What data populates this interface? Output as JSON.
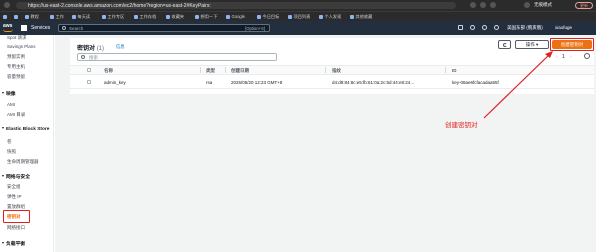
{
  "browser": {
    "url": "https://us-east-2.console.aws.amazon.com/ec2/home?region=us-east-2#KeyPairs:",
    "incognito_label": "无痕模式",
    "update_label": "更新",
    "bookmarks": [
      "",
      "",
      "教程",
      "工作",
      "每天读",
      "工作专区",
      "工作存档",
      "收藏夹",
      "想用一下",
      "Google",
      "今日目标",
      "项目列表",
      "个人发现",
      "其他收藏"
    ]
  },
  "aws_nav": {
    "logo": "aws",
    "services_label": "Services",
    "search_placeholder": "Search",
    "search_shortcut": "[Option+S]",
    "region": "美国东部 (俄亥俄)",
    "user": "xiaofuge"
  },
  "sidebar": {
    "top_items": [
      "Spot 请求",
      "Savings Plans",
      "预留实例",
      "专用主机",
      "容量预留"
    ],
    "sections": [
      {
        "title": "映像",
        "items": [
          "AMI",
          "AMI 目录"
        ]
      },
      {
        "title": "Elastic Block Store",
        "items": [
          "卷",
          "快照",
          "生命周期管理器"
        ]
      },
      {
        "title": "网络与安全",
        "items": [
          "安全组",
          "弹性 IP",
          "置放群组",
          "密钥对",
          "网络接口"
        ]
      },
      {
        "title": "负载平衡",
        "items": []
      }
    ],
    "active_item": "密钥对"
  },
  "main": {
    "title": "密钥对",
    "count": "(1)",
    "info_label": "信息",
    "actions_label": "操作 ▾",
    "create_button": "创建密钥对",
    "filter_placeholder": "搜索",
    "page": "1",
    "columns": [
      "名称",
      "类型",
      "创建日期",
      "指纹",
      "ID"
    ],
    "rows": [
      {
        "name": "admin_key",
        "type": "rsa",
        "created": "2025/05/20 12:23 GMT+8",
        "fingerprint": "d4:d9:84:8c:e5:fb:61:0a:2c:5d:44:e8:24...",
        "id": "key-08ae6fcfacadaa55f"
      }
    ]
  },
  "annotation": {
    "text": "创建密钥对",
    "color": "#e02020"
  }
}
